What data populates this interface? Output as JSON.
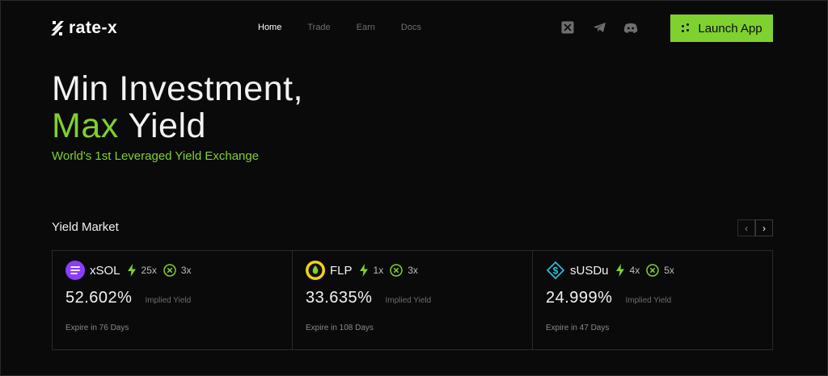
{
  "brand": {
    "name": "rate-x",
    "accent": "#7fd12f"
  },
  "nav": {
    "items": [
      {
        "label": "Home",
        "active": true
      },
      {
        "label": "Trade",
        "active": false
      },
      {
        "label": "Earn",
        "active": false
      },
      {
        "label": "Docs",
        "active": false
      }
    ]
  },
  "socials": [
    "x-icon",
    "telegram-icon",
    "discord-icon"
  ],
  "launch": {
    "label": "Launch App"
  },
  "hero": {
    "line1": "Min Investment,",
    "line2_accent": "Max",
    "line2_rest": " Yield",
    "subtitle": "World's 1st Leveraged Yield Exchange"
  },
  "market": {
    "title": "Yield Market",
    "prev": "‹",
    "next": "›",
    "cards": [
      {
        "token": "xSOL",
        "icon": "xsol-icon",
        "leverage": "25x",
        "multiplier": "3x",
        "yield": "52.602%",
        "yield_label": "Implied Yield",
        "expire": "Expire in 76 Days"
      },
      {
        "token": "FLP",
        "icon": "flp-icon",
        "leverage": "1x",
        "multiplier": "3x",
        "yield": "33.635%",
        "yield_label": "Implied Yield",
        "expire": "Expire in 108 Days"
      },
      {
        "token": "sUSDu",
        "icon": "susdu-icon",
        "leverage": "4x",
        "multiplier": "5x",
        "yield": "24.999%",
        "yield_label": "Implied Yield",
        "expire": "Expire in 47 Days"
      }
    ]
  }
}
